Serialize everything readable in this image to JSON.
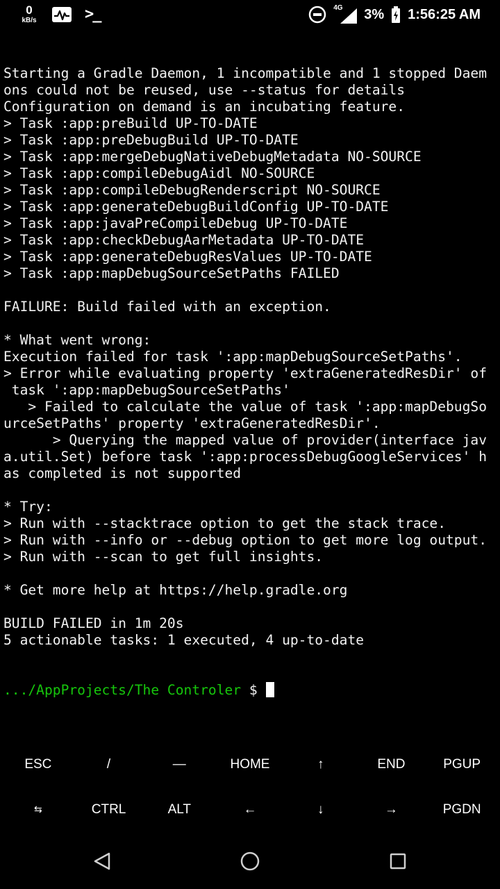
{
  "status_bar": {
    "net_speed_value": "0",
    "net_speed_unit": "kB/s",
    "network_generation": "4G",
    "battery_percent": "3%",
    "time": "1:56:25 AM",
    "icons": [
      "pulse-icon",
      "terminal-icon",
      "do-not-disturb-icon",
      "signal-icon",
      "battery-charging-icon"
    ]
  },
  "terminal": {
    "lines": [
      "Starting a Gradle Daemon, 1 incompatible and 1 stopped Daem",
      "ons could not be reused, use --status for details",
      "Configuration on demand is an incubating feature.",
      "> Task :app:preBuild UP-TO-DATE",
      "> Task :app:preDebugBuild UP-TO-DATE",
      "> Task :app:mergeDebugNativeDebugMetadata NO-SOURCE",
      "> Task :app:compileDebugAidl NO-SOURCE",
      "> Task :app:compileDebugRenderscript NO-SOURCE",
      "> Task :app:generateDebugBuildConfig UP-TO-DATE",
      "> Task :app:javaPreCompileDebug UP-TO-DATE",
      "> Task :app:checkDebugAarMetadata UP-TO-DATE",
      "> Task :app:generateDebugResValues UP-TO-DATE",
      "> Task :app:mapDebugSourceSetPaths FAILED",
      "",
      "FAILURE: Build failed with an exception.",
      "",
      "* What went wrong:",
      "Execution failed for task ':app:mapDebugSourceSetPaths'.",
      "> Error while evaluating property 'extraGeneratedResDir' of",
      " task ':app:mapDebugSourceSetPaths'",
      "   > Failed to calculate the value of task ':app:mapDebugSo",
      "urceSetPaths' property 'extraGeneratedResDir'.",
      "      > Querying the mapped value of provider(interface jav",
      "a.util.Set) before task ':app:processDebugGoogleServices' h",
      "as completed is not supported",
      "",
      "* Try:",
      "> Run with --stacktrace option to get the stack trace.",
      "> Run with --info or --debug option to get more log output.",
      "> Run with --scan to get full insights.",
      "",
      "* Get more help at https://help.gradle.org",
      "",
      "BUILD FAILED in 1m 20s",
      "5 actionable tasks: 1 executed, 4 up-to-date"
    ],
    "prompt_path": ".../AppProjects/The Controler",
    "prompt_symbol": "$"
  },
  "extra_keys": {
    "row1": [
      "ESC",
      "/",
      "—",
      "HOME",
      "↑",
      "END",
      "PGUP"
    ],
    "row2": [
      "⇆",
      "CTRL",
      "ALT",
      "←",
      "↓",
      "→",
      "PGDN"
    ]
  },
  "colors": {
    "background": "#000000",
    "text": "#f2f2f2",
    "prompt_path": "#16c60c"
  }
}
